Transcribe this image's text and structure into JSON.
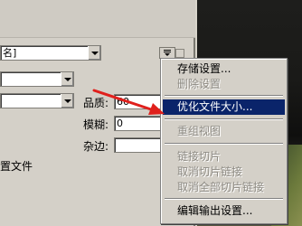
{
  "top_combo": {
    "value": "名]"
  },
  "preset_combo": {
    "value": ""
  },
  "format_combo": {
    "value": ""
  },
  "fields": {
    "quality_label": "品质:",
    "quality_value": "60",
    "blur_label": "模糊:",
    "blur_value": "0",
    "matte_label": "杂边:",
    "matte_value": ""
  },
  "left_text": "置文件",
  "menu": {
    "items": [
      {
        "label": "存储设置...",
        "enabled": true
      },
      {
        "label": "删除设置",
        "enabled": false
      },
      {
        "label": "优化文件大小...",
        "enabled": true,
        "selected": true
      },
      {
        "label": "重组视图",
        "enabled": false
      },
      {
        "label": "链接切片",
        "enabled": false
      },
      {
        "label": "取消切片链接",
        "enabled": false
      },
      {
        "label": "取消全部切片链接",
        "enabled": false
      },
      {
        "label": "编辑输出设置...",
        "enabled": true
      }
    ]
  },
  "colors": {
    "selection": "#0a246a",
    "arrow": "#e0201c",
    "disabled_text": "#8e8b84"
  },
  "icons": [
    "options-menu-icon",
    "dropdown-arrow-icon",
    "red-arrow-annotation"
  ]
}
